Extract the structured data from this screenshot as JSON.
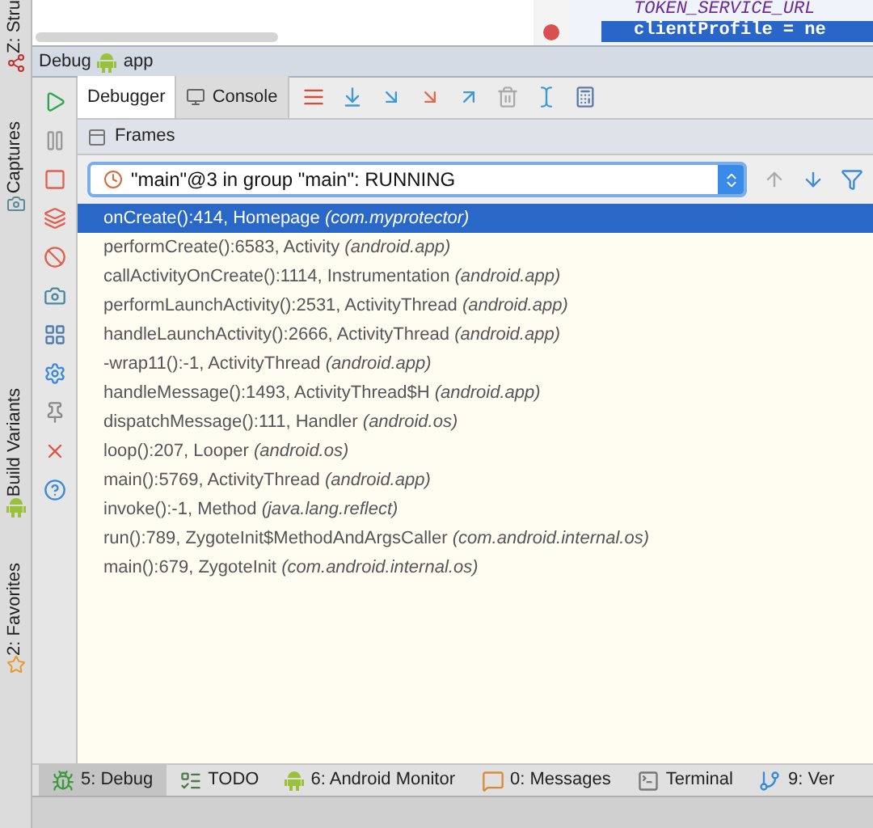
{
  "side_strip": {
    "labels": [
      "Z: Stru",
      "Captures",
      "Build Variants",
      "2: Favorites"
    ]
  },
  "editor": {
    "lines": [
      {
        "text": "TOKEN_SERVICE_URL",
        "selected": false,
        "breakpoint": false
      },
      {
        "text": "clientProfile = ne",
        "selected": true,
        "breakpoint": true
      }
    ]
  },
  "debug_header": {
    "title": "Debug",
    "config": "app"
  },
  "tabs": [
    {
      "label": "Debugger",
      "selected": true
    },
    {
      "label": "Console",
      "selected": false
    }
  ],
  "frames": {
    "title": "Frames",
    "thread": "\"main\"@3 in group \"main\": RUNNING",
    "rows": [
      {
        "text": "onCreate():414, Homepage *(com.myprotector)*",
        "selected": true
      },
      {
        "text": "performCreate():6583, Activity *(android.app)*",
        "selected": false
      },
      {
        "text": "callActivityOnCreate():1114, Instrumentation *(android.app)*",
        "selected": false
      },
      {
        "text": "performLaunchActivity():2531, ActivityThread *(android.app)*",
        "selected": false
      },
      {
        "text": "handleLaunchActivity():2666, ActivityThread *(android.app)*",
        "selected": false
      },
      {
        "text": "-wrap11():-1, ActivityThread *(android.app)*",
        "selected": false
      },
      {
        "text": "handleMessage():1493, ActivityThread$H *(android.app)*",
        "selected": false
      },
      {
        "text": "dispatchMessage():111, Handler *(android.os)*",
        "selected": false
      },
      {
        "text": "loop():207, Looper *(android.os)*",
        "selected": false
      },
      {
        "text": "main():5769, ActivityThread *(android.app)*",
        "selected": false
      },
      {
        "text": "invoke():-1, Method *(java.lang.reflect)*",
        "selected": false
      },
      {
        "text": "run():789, ZygoteInit$MethodAndArgsCaller *(com.android.internal.os)*",
        "selected": false
      },
      {
        "text": "main():679, ZygoteInit *(com.android.internal.os)*",
        "selected": false
      }
    ]
  },
  "bottom_tabs": [
    {
      "label": "5: Debug",
      "selected": true,
      "kind": "debug"
    },
    {
      "label": "TODO",
      "selected": false,
      "kind": "todo"
    },
    {
      "label": "6: Android Monitor",
      "selected": false,
      "kind": "android"
    },
    {
      "label": "0: Messages",
      "selected": false,
      "kind": "messages"
    },
    {
      "label": "Terminal",
      "selected": false,
      "kind": "terminal"
    },
    {
      "label": "9: Ver",
      "selected": false,
      "kind": "vcs"
    }
  ]
}
